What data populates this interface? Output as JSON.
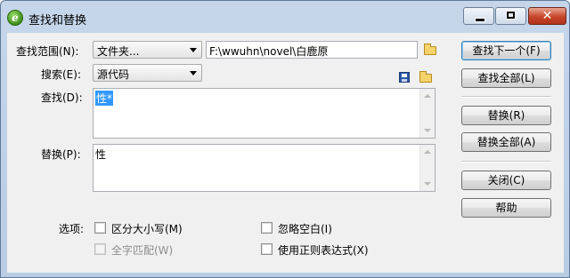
{
  "window": {
    "title": "查找和替换"
  },
  "titlebar": {
    "minimize_label": "",
    "maximize_label": "",
    "close_label": "✕"
  },
  "search_scope": {
    "label": "查找范围(N):",
    "value": "文件夹...",
    "path": "F:\\wwuhn\\novel\\白鹿原"
  },
  "search_in": {
    "label": "搜索(E):",
    "value": "源代码"
  },
  "find": {
    "label": "查找(D):",
    "value": "性*"
  },
  "replace": {
    "label": "替换(P):",
    "value": "性"
  },
  "buttons": {
    "find_next": "查找下一个(F)",
    "find_all": "查找全部(L)",
    "replace": "替换(R)",
    "replace_all": "替换全部(A)",
    "close": "关闭(C)",
    "help": "帮助"
  },
  "options": {
    "label": "选项:",
    "match_case": {
      "label": "区分大小写(M)",
      "checked": false,
      "enabled": true
    },
    "whole_word": {
      "label": "全字匹配(W)",
      "checked": false,
      "enabled": false
    },
    "ignore_whitespace": {
      "label": "忽略空白(I)",
      "checked": false,
      "enabled": true
    },
    "use_regex": {
      "label": "使用正则表达式(X)",
      "checked": false,
      "enabled": true
    }
  },
  "icons": {
    "app": "dreamweaver-icon",
    "browse": "folder-icon",
    "save_query": "save-icon",
    "load_query": "open-folder-icon"
  },
  "colors": {
    "selection": "#3399ff",
    "close_button": "#c7462a",
    "titlebar": "#c6d6ea"
  }
}
